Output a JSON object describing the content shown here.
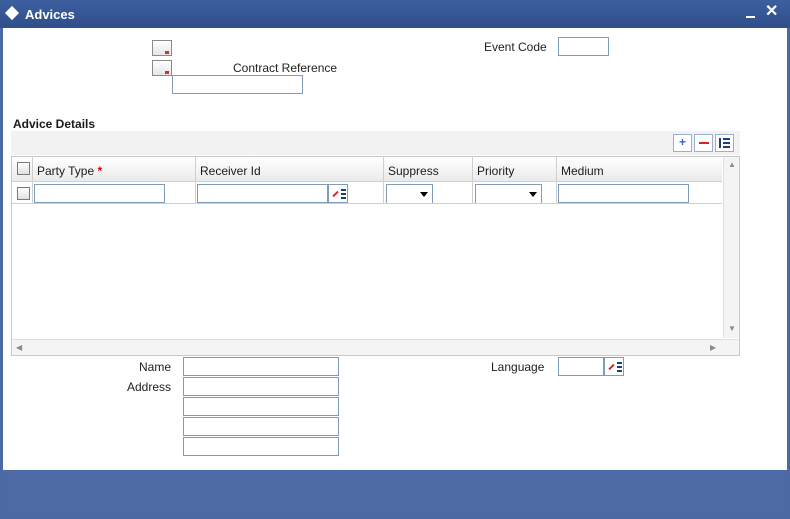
{
  "window": {
    "title": "Advices"
  },
  "header": {
    "event_code_label": "Event Code",
    "event_code_value": "",
    "contract_reference_label": "Contract Reference",
    "contract_reference_value": ""
  },
  "advice_details": {
    "title": "Advice Details",
    "columns": {
      "party_type": "Party Type",
      "required_mark": "*",
      "receiver_id": "Receiver Id",
      "suppress": "Suppress",
      "priority": "Priority",
      "medium": "Medium"
    },
    "rows": [
      {
        "party_type": "",
        "receiver_id": "",
        "suppress": "",
        "priority": "",
        "medium": ""
      }
    ]
  },
  "footer_form": {
    "name_label": "Name",
    "name_value": "",
    "address_label": "Address",
    "address_lines": [
      "",
      "",
      "",
      ""
    ],
    "language_label": "Language",
    "language_value": ""
  },
  "icons": {
    "add": "plus-icon",
    "delete": "minus-icon",
    "view": "list-icon",
    "lov": "lov-icon",
    "minimize": "minimize-icon",
    "close": "close-icon"
  }
}
